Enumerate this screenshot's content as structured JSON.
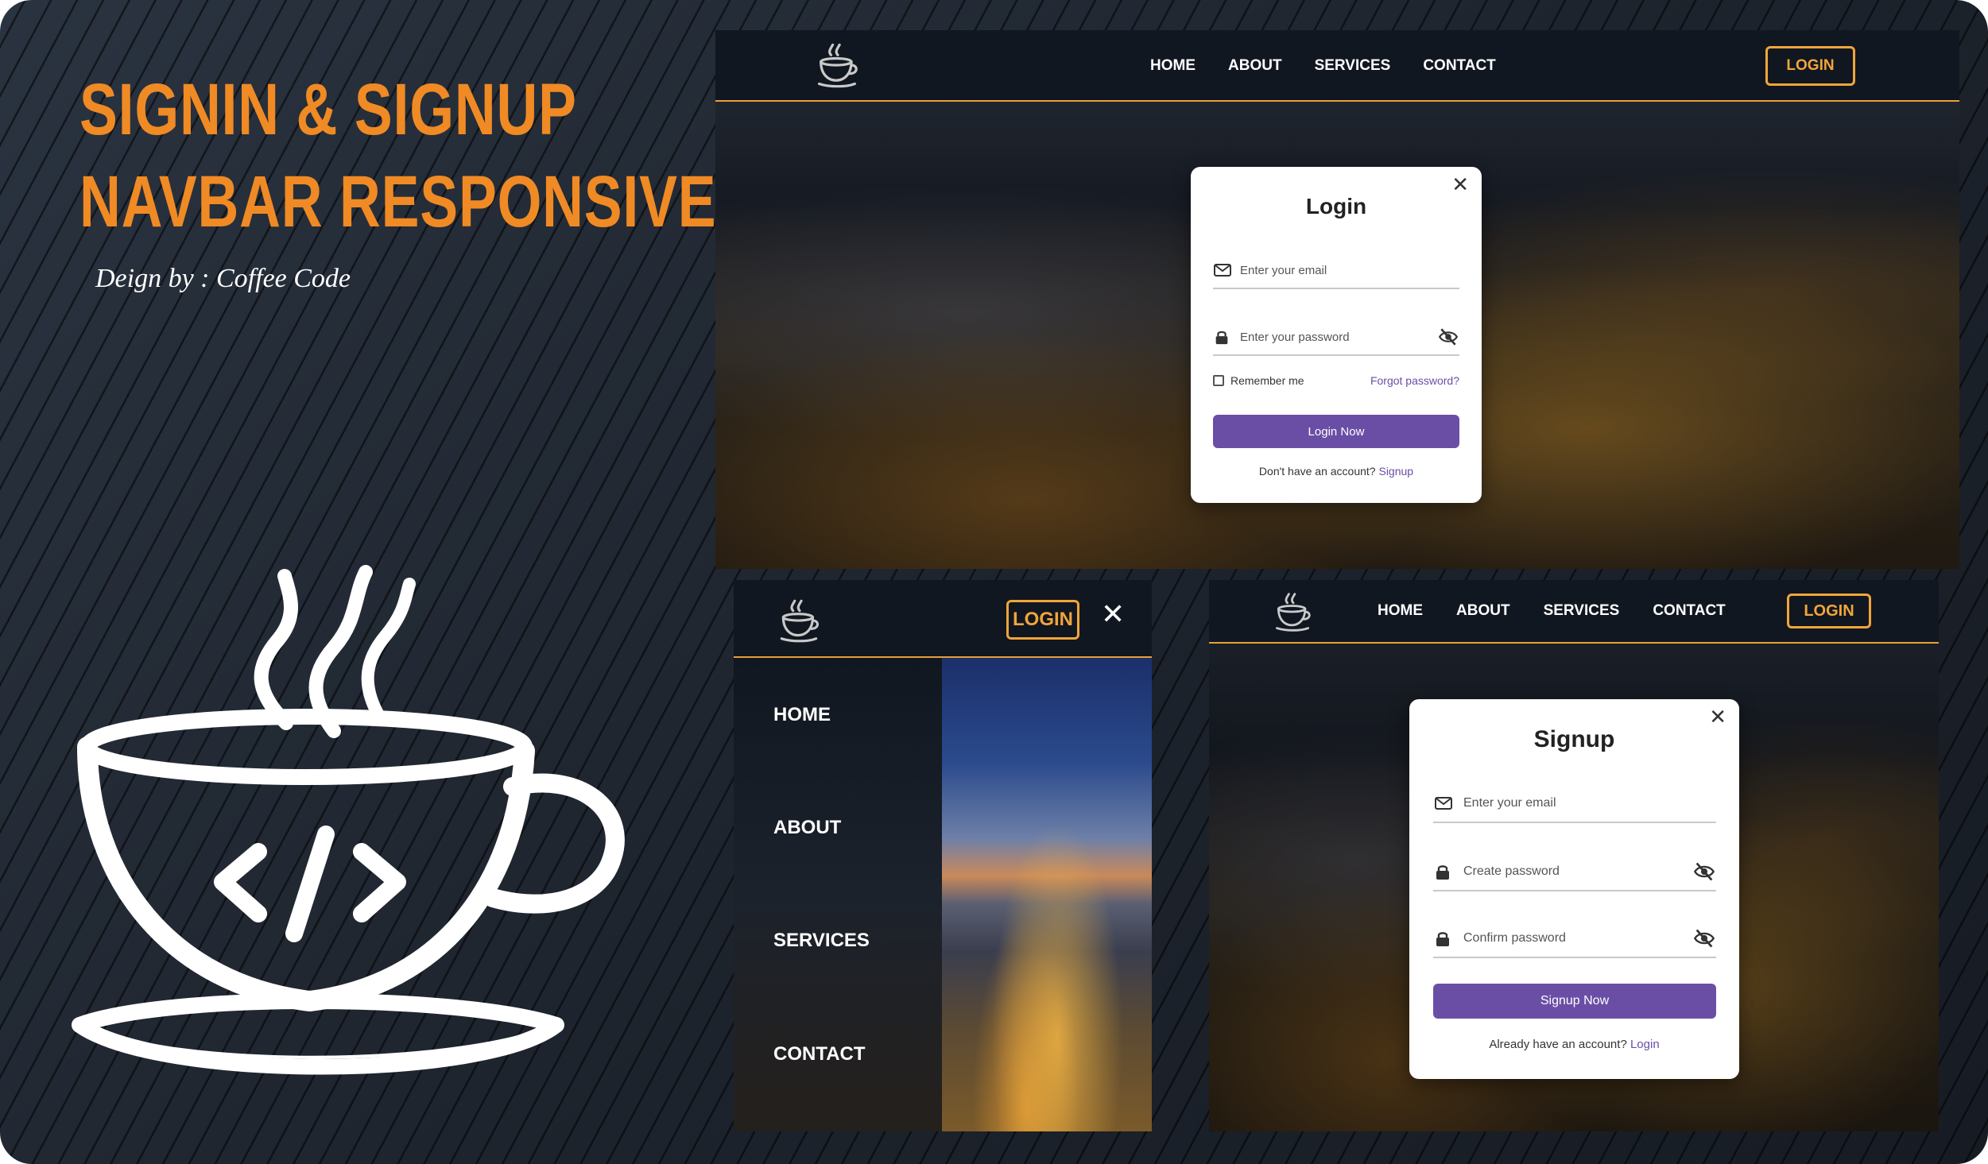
{
  "promo": {
    "title_line1": "SIGNIN & SIGNUP",
    "title_line2": "NAVBAR RESPONSIVE",
    "byline": "Deign by : Coffee Code"
  },
  "colors": {
    "accent": "#f08a24",
    "nav_border": "#e7a03a",
    "button_purple": "#6a4ea6",
    "nav_bg": "#111720"
  },
  "desktop_login": {
    "nav": {
      "links": [
        "HOME",
        "ABOUT",
        "SERVICES",
        "CONTACT"
      ],
      "login_label": "LOGIN"
    },
    "modal": {
      "title": "Login",
      "email_placeholder": "Enter your email",
      "password_placeholder": "Enter your password",
      "remember_label": "Remember me",
      "forgot_label": "Forgot password?",
      "submit_label": "Login Now",
      "switch_text": "Don't have an account?",
      "switch_link": "Signup"
    }
  },
  "mobile": {
    "login_label": "LOGIN",
    "menu_items": [
      "HOME",
      "ABOUT",
      "SERVICES",
      "CONTACT"
    ]
  },
  "desktop_signup": {
    "nav": {
      "links": [
        "HOME",
        "ABOUT",
        "SERVICES",
        "CONTACT"
      ],
      "login_label": "LOGIN"
    },
    "modal": {
      "title": "Signup",
      "email_placeholder": "Enter your email",
      "password_placeholder": "Create password",
      "confirm_placeholder": "Confirm password",
      "submit_label": "Signup Now",
      "switch_text": "Already have an account?",
      "switch_link": "Login"
    }
  },
  "icons": [
    "coffee-code-logo-icon",
    "envelope-icon",
    "lock-icon",
    "eye-off-icon",
    "close-icon",
    "checkbox"
  ]
}
